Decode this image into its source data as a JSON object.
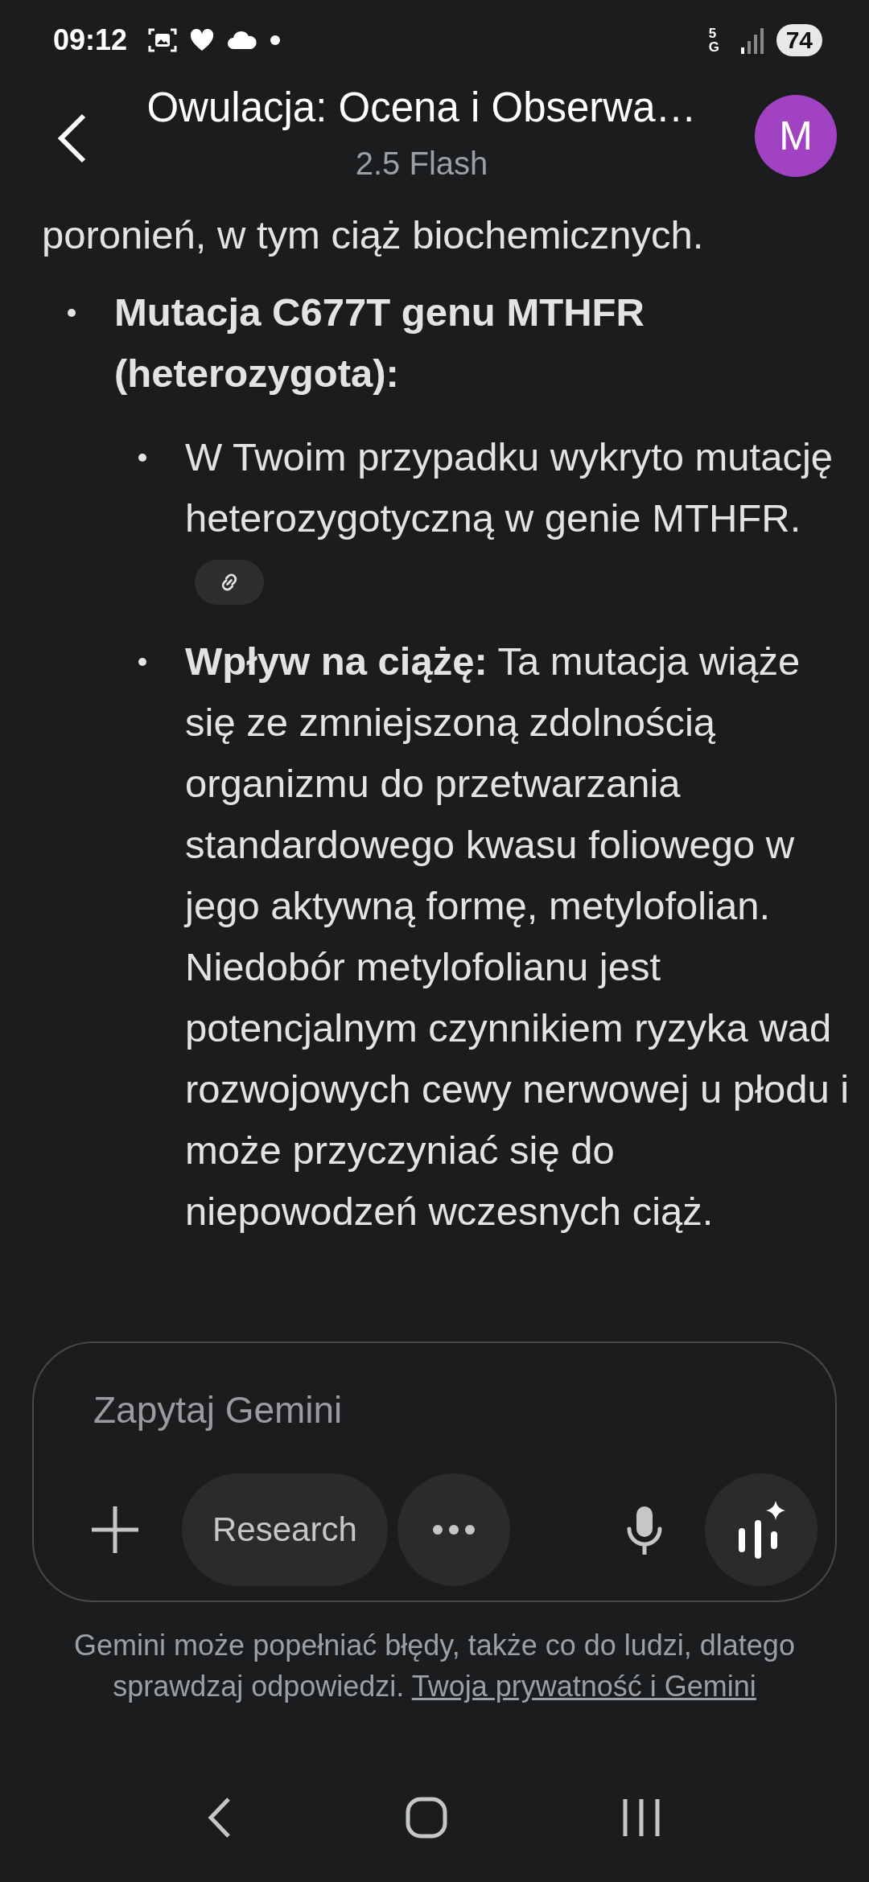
{
  "status_bar": {
    "time": "09:12",
    "network": "5G",
    "battery": "74"
  },
  "header": {
    "title": "Owulacja: Ocena i Obserwa…",
    "subtitle": "2.5 Flash",
    "avatar": "M"
  },
  "message": {
    "cut_line": "poronień, w tym ciąż biochemicznych.",
    "items": [
      {
        "heading": "Mutacja C677T genu MTHFR (heterozygota):",
        "children": [
          {
            "text": "W Twoim przypadku wykryto mutację heterozygotyczną w genie MTHFR.",
            "has_link": true
          },
          {
            "text": "**Wpływ na ciążę:** Ta mutacja wiąże się ze zmniejszoną zdolnością organizmu do przetwarzania standardowego kwasu foliowego w jego aktywną formę, metylofolian. Niedobór metylofolianu jest potencjalnym czynnikiem ryzyka wad rozwojowych cewy nerwowej u płodu i może przyczyniać się do niepowodzeń wczesnych ciąż.",
            "has_link": false
          }
        ]
      }
    ]
  },
  "composer": {
    "placeholder": "Zapytaj Gemini",
    "chip": "Research"
  },
  "disclaimer": {
    "text": "Gemini może popełniać błędy, także co do ludzi, dlatego sprawdzaj odpowiedzi.",
    "link": "Twoja prywatność i Gemini"
  }
}
